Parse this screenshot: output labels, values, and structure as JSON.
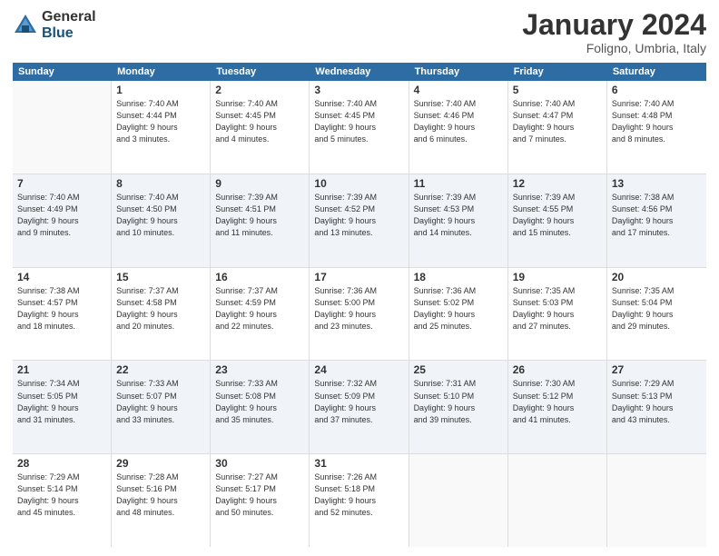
{
  "logo": {
    "general": "General",
    "blue": "Blue"
  },
  "title": {
    "month": "January 2024",
    "location": "Foligno, Umbria, Italy"
  },
  "header_days": [
    "Sunday",
    "Monday",
    "Tuesday",
    "Wednesday",
    "Thursday",
    "Friday",
    "Saturday"
  ],
  "weeks": [
    {
      "alt": false,
      "days": [
        {
          "num": "",
          "data": ""
        },
        {
          "num": "1",
          "data": "Sunrise: 7:40 AM\nSunset: 4:44 PM\nDaylight: 9 hours\nand 3 minutes."
        },
        {
          "num": "2",
          "data": "Sunrise: 7:40 AM\nSunset: 4:45 PM\nDaylight: 9 hours\nand 4 minutes."
        },
        {
          "num": "3",
          "data": "Sunrise: 7:40 AM\nSunset: 4:45 PM\nDaylight: 9 hours\nand 5 minutes."
        },
        {
          "num": "4",
          "data": "Sunrise: 7:40 AM\nSunset: 4:46 PM\nDaylight: 9 hours\nand 6 minutes."
        },
        {
          "num": "5",
          "data": "Sunrise: 7:40 AM\nSunset: 4:47 PM\nDaylight: 9 hours\nand 7 minutes."
        },
        {
          "num": "6",
          "data": "Sunrise: 7:40 AM\nSunset: 4:48 PM\nDaylight: 9 hours\nand 8 minutes."
        }
      ]
    },
    {
      "alt": true,
      "days": [
        {
          "num": "7",
          "data": "Sunrise: 7:40 AM\nSunset: 4:49 PM\nDaylight: 9 hours\nand 9 minutes."
        },
        {
          "num": "8",
          "data": "Sunrise: 7:40 AM\nSunset: 4:50 PM\nDaylight: 9 hours\nand 10 minutes."
        },
        {
          "num": "9",
          "data": "Sunrise: 7:39 AM\nSunset: 4:51 PM\nDaylight: 9 hours\nand 11 minutes."
        },
        {
          "num": "10",
          "data": "Sunrise: 7:39 AM\nSunset: 4:52 PM\nDaylight: 9 hours\nand 13 minutes."
        },
        {
          "num": "11",
          "data": "Sunrise: 7:39 AM\nSunset: 4:53 PM\nDaylight: 9 hours\nand 14 minutes."
        },
        {
          "num": "12",
          "data": "Sunrise: 7:39 AM\nSunset: 4:55 PM\nDaylight: 9 hours\nand 15 minutes."
        },
        {
          "num": "13",
          "data": "Sunrise: 7:38 AM\nSunset: 4:56 PM\nDaylight: 9 hours\nand 17 minutes."
        }
      ]
    },
    {
      "alt": false,
      "days": [
        {
          "num": "14",
          "data": "Sunrise: 7:38 AM\nSunset: 4:57 PM\nDaylight: 9 hours\nand 18 minutes."
        },
        {
          "num": "15",
          "data": "Sunrise: 7:37 AM\nSunset: 4:58 PM\nDaylight: 9 hours\nand 20 minutes."
        },
        {
          "num": "16",
          "data": "Sunrise: 7:37 AM\nSunset: 4:59 PM\nDaylight: 9 hours\nand 22 minutes."
        },
        {
          "num": "17",
          "data": "Sunrise: 7:36 AM\nSunset: 5:00 PM\nDaylight: 9 hours\nand 23 minutes."
        },
        {
          "num": "18",
          "data": "Sunrise: 7:36 AM\nSunset: 5:02 PM\nDaylight: 9 hours\nand 25 minutes."
        },
        {
          "num": "19",
          "data": "Sunrise: 7:35 AM\nSunset: 5:03 PM\nDaylight: 9 hours\nand 27 minutes."
        },
        {
          "num": "20",
          "data": "Sunrise: 7:35 AM\nSunset: 5:04 PM\nDaylight: 9 hours\nand 29 minutes."
        }
      ]
    },
    {
      "alt": true,
      "days": [
        {
          "num": "21",
          "data": "Sunrise: 7:34 AM\nSunset: 5:05 PM\nDaylight: 9 hours\nand 31 minutes."
        },
        {
          "num": "22",
          "data": "Sunrise: 7:33 AM\nSunset: 5:07 PM\nDaylight: 9 hours\nand 33 minutes."
        },
        {
          "num": "23",
          "data": "Sunrise: 7:33 AM\nSunset: 5:08 PM\nDaylight: 9 hours\nand 35 minutes."
        },
        {
          "num": "24",
          "data": "Sunrise: 7:32 AM\nSunset: 5:09 PM\nDaylight: 9 hours\nand 37 minutes."
        },
        {
          "num": "25",
          "data": "Sunrise: 7:31 AM\nSunset: 5:10 PM\nDaylight: 9 hours\nand 39 minutes."
        },
        {
          "num": "26",
          "data": "Sunrise: 7:30 AM\nSunset: 5:12 PM\nDaylight: 9 hours\nand 41 minutes."
        },
        {
          "num": "27",
          "data": "Sunrise: 7:29 AM\nSunset: 5:13 PM\nDaylight: 9 hours\nand 43 minutes."
        }
      ]
    },
    {
      "alt": false,
      "days": [
        {
          "num": "28",
          "data": "Sunrise: 7:29 AM\nSunset: 5:14 PM\nDaylight: 9 hours\nand 45 minutes."
        },
        {
          "num": "29",
          "data": "Sunrise: 7:28 AM\nSunset: 5:16 PM\nDaylight: 9 hours\nand 48 minutes."
        },
        {
          "num": "30",
          "data": "Sunrise: 7:27 AM\nSunset: 5:17 PM\nDaylight: 9 hours\nand 50 minutes."
        },
        {
          "num": "31",
          "data": "Sunrise: 7:26 AM\nSunset: 5:18 PM\nDaylight: 9 hours\nand 52 minutes."
        },
        {
          "num": "",
          "data": ""
        },
        {
          "num": "",
          "data": ""
        },
        {
          "num": "",
          "data": ""
        }
      ]
    }
  ]
}
